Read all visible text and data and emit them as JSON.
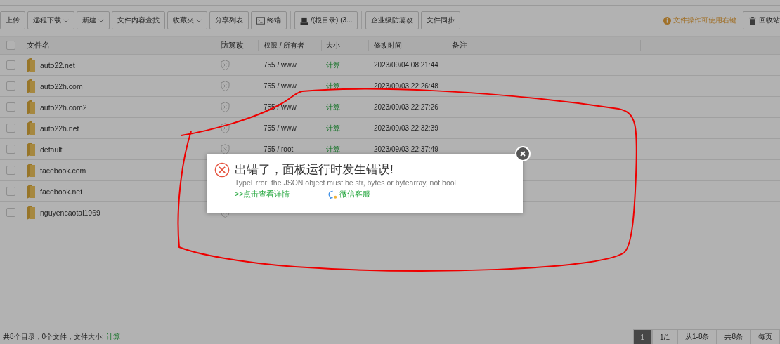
{
  "toolbar": {
    "groups": [
      [
        {
          "label": "上传",
          "kind": "plain"
        },
        {
          "label": "远程下载",
          "kind": "dropdown"
        },
        {
          "label": "新建",
          "kind": "dropdown"
        },
        {
          "label": "文件内容查找",
          "kind": "plain"
        },
        {
          "label": "收藏夹",
          "kind": "dropdown"
        },
        {
          "label": "分享列表",
          "kind": "plain"
        },
        {
          "label": "终端",
          "kind": "terminal"
        }
      ],
      [
        {
          "label": "/(根目录) (3...",
          "kind": "drive"
        }
      ],
      [
        {
          "label": "企业级防篡改",
          "kind": "plain"
        },
        {
          "label": "文件同步",
          "kind": "plain"
        }
      ]
    ],
    "hint": "文件操作可使用右键",
    "recycle_button": "回收站"
  },
  "table": {
    "select_all_checked": false,
    "columns": [
      "文件名",
      "防篡改",
      "权限 / 所有者",
      "大小",
      "修改时间",
      "备注"
    ],
    "rows": [
      {
        "name": "auto22.net",
        "checked": false,
        "permission": "755 / www",
        "size": "计算",
        "modified": "2023/09/04 08:21:44"
      },
      {
        "name": "auto22h.com",
        "checked": false,
        "permission": "755 / www",
        "size": "计算",
        "modified": "2023/09/03 22:26:48"
      },
      {
        "name": "auto22h.com2",
        "checked": false,
        "permission": "755 / www",
        "size": "计算",
        "modified": "2023/09/03 22:27:26"
      },
      {
        "name": "auto22h.net",
        "checked": false,
        "permission": "755 / www",
        "size": "计算",
        "modified": "2023/09/03 22:32:39"
      },
      {
        "name": "default",
        "checked": false,
        "permission": "755 / root",
        "size": "计算",
        "modified": "2023/09/03 22:37:49"
      },
      {
        "name": "facebook.com",
        "checked": false,
        "shield_visible": false
      },
      {
        "name": "facebook.net",
        "checked": false,
        "shield_visible": false
      },
      {
        "name": "nguyencaotai1969",
        "checked": false,
        "shield_visible": true
      }
    ]
  },
  "footer": {
    "summary": "共8个目录，0个文件，文件大小:",
    "size_link": "计算",
    "pagination": [
      {
        "label": "1",
        "selected": true
      },
      {
        "label": "1/1",
        "selected": false
      },
      {
        "label": "从1-8条",
        "selected": false
      },
      {
        "label": "共8条",
        "selected": false
      },
      {
        "label": "每页",
        "selected": false
      }
    ]
  },
  "dialog": {
    "title": "出错了，面板运行时发生错误!",
    "message": "TypeError: the JSON object must be str, bytes or bytearray, not bool",
    "details_link": ">>点击查看详情",
    "support_link": "微信客服"
  }
}
